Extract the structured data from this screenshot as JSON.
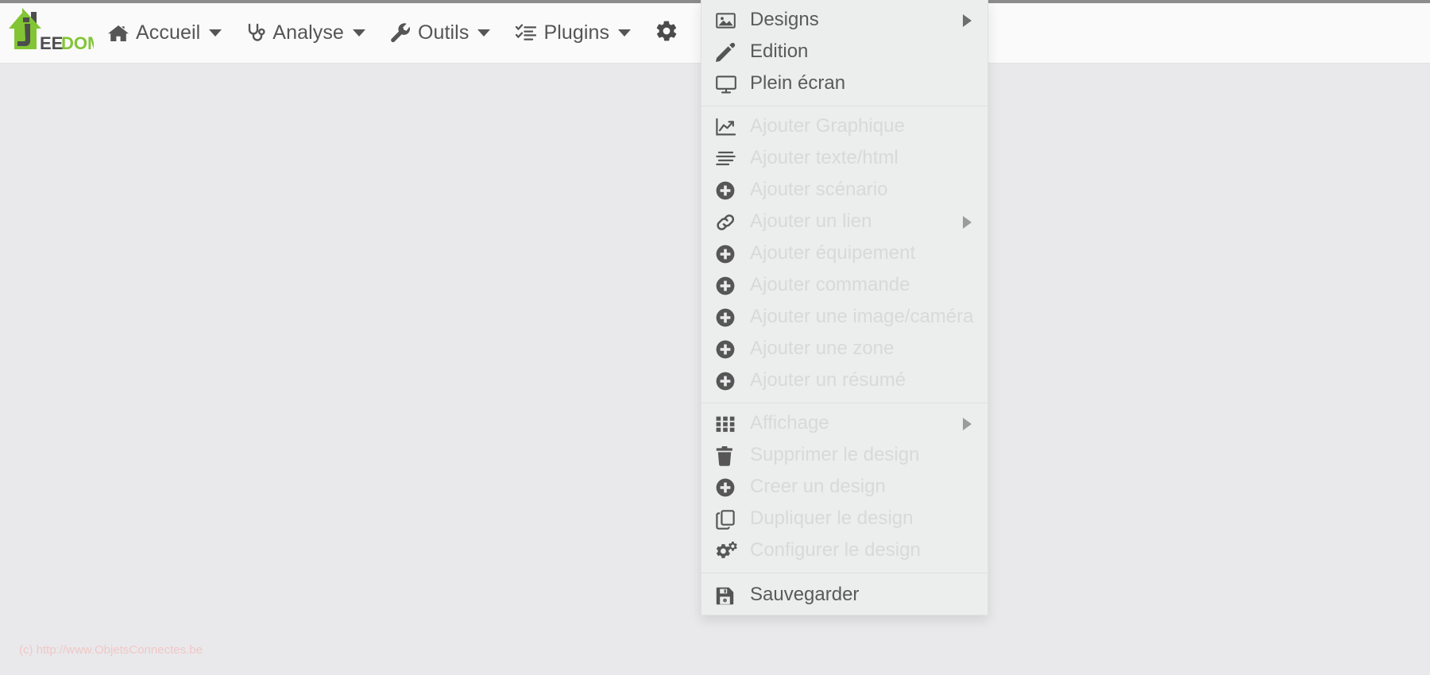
{
  "page": {
    "background_color": "#e9e9eb",
    "top_rule_color": "#8c8c8c"
  },
  "navbar": {
    "background_color": "#fafafa",
    "brand": {
      "name": "jeedom-logo",
      "text_dark": "EE",
      "text_green": "DOM",
      "green": "#81c534",
      "dark": "#4d4d4d"
    },
    "items": [
      {
        "label": "Accueil",
        "icon": "home-icon",
        "has_caret": true
      },
      {
        "label": "Analyse",
        "icon": "stethoscope-icon",
        "has_caret": true
      },
      {
        "label": "Outils",
        "icon": "wrench-icon",
        "has_caret": true
      },
      {
        "label": "Plugins",
        "icon": "tasks-list-icon",
        "has_caret": true
      }
    ],
    "gear": {
      "label": "",
      "icon": "gear-icon"
    }
  },
  "design_menu": {
    "sections": [
      {
        "items": [
          {
            "label": "Designs",
            "icon": "image-icon",
            "disabled": false,
            "submenu": true
          },
          {
            "label": "Edition",
            "icon": "pencil-icon",
            "disabled": false,
            "submenu": false
          },
          {
            "label": "Plein écran",
            "icon": "desktop-icon",
            "disabled": false,
            "submenu": false
          }
        ]
      },
      {
        "items": [
          {
            "label": "Ajouter Graphique",
            "icon": "chart-line-icon",
            "disabled": true,
            "submenu": false
          },
          {
            "label": "Ajouter texte/html",
            "icon": "align-text-icon",
            "disabled": true,
            "submenu": false
          },
          {
            "label": "Ajouter scénario",
            "icon": "plus-circle-icon",
            "disabled": true,
            "submenu": false
          },
          {
            "label": "Ajouter un lien",
            "icon": "link-icon",
            "disabled": true,
            "submenu": true
          },
          {
            "label": "Ajouter équipement",
            "icon": "plus-circle-icon",
            "disabled": true,
            "submenu": false
          },
          {
            "label": "Ajouter commande",
            "icon": "plus-circle-icon",
            "disabled": true,
            "submenu": false
          },
          {
            "label": "Ajouter une image/caméra",
            "icon": "plus-circle-icon",
            "disabled": true,
            "submenu": false
          },
          {
            "label": "Ajouter une zone",
            "icon": "plus-circle-icon",
            "disabled": true,
            "submenu": false
          },
          {
            "label": "Ajouter un résumé",
            "icon": "plus-circle-icon",
            "disabled": true,
            "submenu": false
          }
        ]
      },
      {
        "items": [
          {
            "label": "Affichage",
            "icon": "grid-icon",
            "disabled": true,
            "submenu": true
          },
          {
            "label": "Supprimer le design",
            "icon": "trash-icon",
            "disabled": true,
            "submenu": false
          },
          {
            "label": "Creer un design",
            "icon": "plus-circle-icon",
            "disabled": true,
            "submenu": false
          },
          {
            "label": "Dupliquer le design",
            "icon": "copy-icon",
            "disabled": true,
            "submenu": false
          },
          {
            "label": "Configurer le design",
            "icon": "cogs-icon",
            "disabled": true,
            "submenu": false
          }
        ]
      },
      {
        "items": [
          {
            "label": "Sauvegarder",
            "icon": "save-icon",
            "disabled": false,
            "submenu": false
          }
        ]
      }
    ]
  },
  "footer": {
    "text": "(c) http://www.ObjetsConnectes.be",
    "color": "#f0c7c7"
  }
}
